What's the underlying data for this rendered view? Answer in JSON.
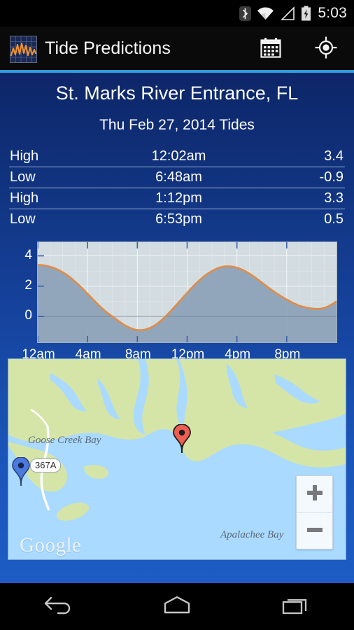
{
  "status_bar": {
    "clock": "5:03",
    "icons": [
      "bluetooth-icon",
      "wifi-icon",
      "cell-signal-icon",
      "battery-charging-icon"
    ]
  },
  "action_bar": {
    "app_icon": "tide-waveform-icon",
    "title": "Tide Predictions",
    "actions": [
      {
        "name": "calendar-action",
        "icon": "calendar-icon"
      },
      {
        "name": "locate-action",
        "icon": "my-location-icon"
      }
    ],
    "accent_color": "#2f9fdc"
  },
  "main": {
    "station_name": "St. Marks River Entrance, FL",
    "date_heading": "Thu Feb 27, 2014 Tides",
    "tides": [
      {
        "type": "High",
        "time": "12:02am",
        "height": "3.4"
      },
      {
        "type": "Low",
        "time": "6:48am",
        "height": "-0.9"
      },
      {
        "type": "High",
        "time": "1:12pm",
        "height": "3.3"
      },
      {
        "type": "Low",
        "time": "6:53pm",
        "height": "0.5"
      }
    ]
  },
  "chart_data": {
    "type": "line",
    "title": "",
    "xlabel": "",
    "ylabel": "",
    "curve_color": "#e08c46",
    "fill_color": "#8ea2b8",
    "plot_bg": "#d2dce1",
    "grid": true,
    "xlim": [
      0,
      24
    ],
    "ylim": [
      -1.7,
      4.9
    ],
    "y_ticks": [
      "4",
      "2",
      "0"
    ],
    "y_tick_values": [
      4,
      2,
      0
    ],
    "x_ticks": [
      "12am",
      "4am",
      "8am",
      "12pm",
      "4pm",
      "8pm"
    ],
    "x_tick_values": [
      0,
      4,
      8,
      12,
      16,
      20
    ],
    "x": [
      0,
      0.5,
      1,
      1.5,
      2,
      2.5,
      3,
      3.5,
      4,
      4.5,
      5,
      5.5,
      6,
      6.5,
      7,
      7.5,
      8,
      8.5,
      9,
      9.5,
      10,
      10.5,
      11,
      11.5,
      12,
      12.5,
      13,
      13.5,
      14,
      14.5,
      15,
      15.5,
      16,
      16.5,
      17,
      17.5,
      18,
      18.5,
      19,
      19.5,
      20,
      20.5,
      21,
      21.5,
      22,
      22.5,
      23,
      23.5,
      24
    ],
    "y": [
      3.4,
      3.37,
      3.28,
      3.13,
      2.92,
      2.64,
      2.3,
      1.92,
      1.5,
      1.08,
      0.67,
      0.3,
      0.0,
      -0.3,
      -0.58,
      -0.78,
      -0.89,
      -0.88,
      -0.76,
      -0.53,
      -0.2,
      0.2,
      0.64,
      1.1,
      1.56,
      2.0,
      2.4,
      2.74,
      3.0,
      3.2,
      3.3,
      3.3,
      3.22,
      3.06,
      2.83,
      2.55,
      2.24,
      1.93,
      1.63,
      1.36,
      1.12,
      0.9,
      0.72,
      0.6,
      0.53,
      0.5,
      0.56,
      0.74,
      1.0
    ],
    "extremes": [
      {
        "label": "High",
        "time": "12:02am",
        "value": 3.4
      },
      {
        "label": "Low",
        "time": "6:48am",
        "value": -0.9
      },
      {
        "label": "High",
        "time": "1:12pm",
        "value": 3.3
      },
      {
        "label": "Low",
        "time": "6:53pm",
        "value": 0.5
      }
    ]
  },
  "map": {
    "labels": [
      {
        "name": "map-label-goose-creek-bay",
        "text": "Goose Creek Bay"
      },
      {
        "name": "map-label-apalachee-bay",
        "text": "Apalachee Bay"
      }
    ],
    "road_shield": "367A",
    "attribution": "Google",
    "markers": [
      {
        "name": "station-pin",
        "color": "#ef5e52"
      },
      {
        "name": "current-location-pin",
        "color": "#4a7ae0"
      }
    ],
    "zoom_in_label": "+",
    "zoom_out_label": "−",
    "water_color": "#aadaff",
    "land_color": "#d5e5a8"
  },
  "nav_bar": {
    "buttons": [
      {
        "name": "nav-back-button",
        "icon": "back-arrow-icon"
      },
      {
        "name": "nav-home-button",
        "icon": "home-icon"
      },
      {
        "name": "nav-recents-button",
        "icon": "recents-icon"
      }
    ]
  }
}
